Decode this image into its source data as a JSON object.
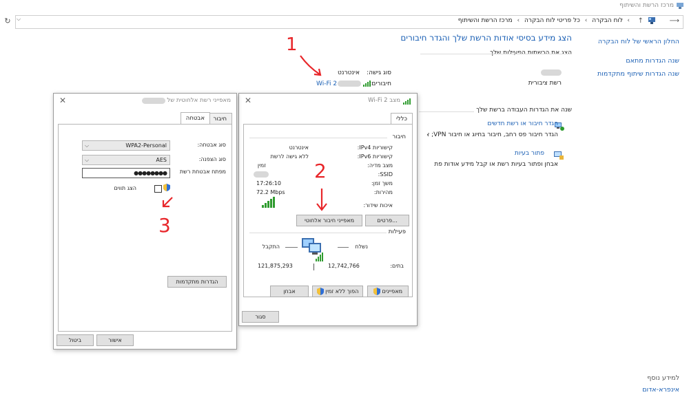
{
  "window": {
    "title": "מרכז הרשת והשיתוף"
  },
  "address_bar": {
    "crumbs": [
      "לוח הבקרה",
      "כל פריטי לוח הבקרה",
      "מרכז הרשת והשיתוף"
    ]
  },
  "sidebar": {
    "items": [
      "החלון הראשי של לוח הבקרה",
      "שנה הגדרות מתאם",
      "שנה הגדרות שיתוף מתקדמות"
    ],
    "see_also_title": "למידע נוסף",
    "see_also": [
      "אינפרא-אדום"
    ]
  },
  "main": {
    "title": "הצג מידע בסיסי אודות הרשת שלך והגדר חיבורים",
    "active_networks_header": "הצג את הרשתות הפעילות שלך",
    "network_type": "רשת ציבורית",
    "access_type_label": "סוג גישה:",
    "access_type_value": "אינטרנט",
    "connections_label": "חיבורים:",
    "connection_link": "Wi-Fi 2",
    "change_settings_header": "שנה את הגדרות העבודה ברשת שלך",
    "task1_link": "הגדר חיבור או רשת חדשים",
    "task1_desc": "הגדר חיבור פס רחב, חיבור בחיוג או חיבור VPN; או הגדר",
    "task2_link": "פתור בעיות",
    "task2_desc": "אבחן ופתור בעיות רשת או קבל מידע אודות פת"
  },
  "status_dialog": {
    "title": "מצב Wi-Fi 2",
    "tab_general": "כללי",
    "connection_legend": "חיבור",
    "rows": [
      {
        "label": "קישוריות IPv4:",
        "value": "אינטרנט"
      },
      {
        "label": "קישוריות IPv6:",
        "value": "ללא גישה לרשת"
      },
      {
        "label": "מצב מדיה:",
        "value": "זמין"
      },
      {
        "label": "SSID:",
        "value": ""
      },
      {
        "label": "משך זמן:",
        "value": "17:26:10"
      },
      {
        "label": "מהירות:",
        "value": "72.2 Mbps"
      }
    ],
    "signal_quality_label": "איכות שידור:",
    "details_button": "פרטים...",
    "wireless_props_button": "מאפייני חיבור אלחוטי",
    "activity_legend": "פעילות",
    "sent_label": "נשלח",
    "received_label": "התקבל",
    "bytes_label": "בתים:",
    "bytes_sent": "12,742,766",
    "bytes_received": "121,875,293",
    "properties_button": "מאפיינים",
    "disable_button": "הפוך ללא זמין",
    "diagnose_button": "אבחן",
    "close_button": "סגור"
  },
  "props_dialog": {
    "title": "מאפייני רשת אלחוטית של",
    "tab_connection": "חיבור",
    "tab_security": "אבטחה",
    "security_type_label": "סוג אבטחה:",
    "security_type_value": "WPA2-Personal",
    "encryption_type_label": "סוג הצפנה:",
    "encryption_type_value": "AES",
    "key_label": "מפתח אבטחת רשת",
    "key_value": "●●●●●●●●",
    "show_chars_label": "הצג תווים",
    "advanced_button": "הגדרות מתקדמות",
    "ok_button": "אישור",
    "cancel_button": "ביטול"
  },
  "annotations": [
    "1",
    "2",
    "3"
  ],
  "colors": {
    "link": "#1a5fb4",
    "annotation": "#e8262a",
    "signal": "#2e9b2e"
  }
}
